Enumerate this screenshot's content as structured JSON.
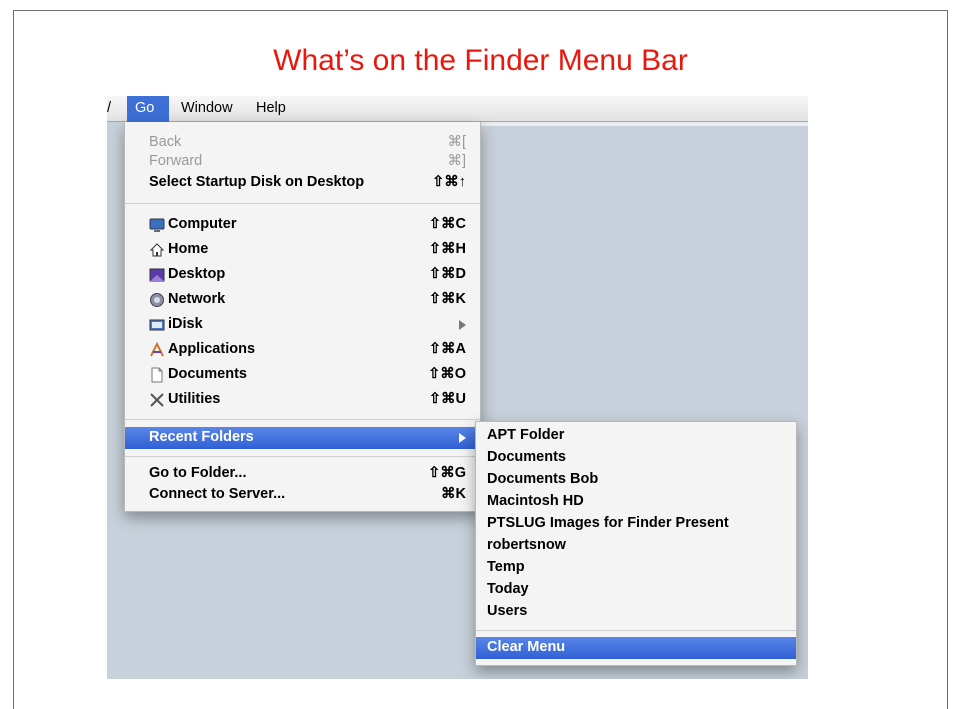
{
  "slide": {
    "title": "What’s on the Finder Menu Bar"
  },
  "menubar": {
    "cut_label": "/",
    "go": "Go",
    "window": "Window",
    "help": "Help"
  },
  "go_menu": {
    "back": {
      "label": "Back",
      "shortcut": "⌘["
    },
    "forward": {
      "label": "Forward",
      "shortcut": "⌘]"
    },
    "startup": {
      "label": "Select Startup Disk on Desktop",
      "shortcut": "⇧⌘↑"
    },
    "places": [
      {
        "label": "Computer",
        "shortcut": "⇧⌘C",
        "icon": "computer-icon"
      },
      {
        "label": "Home",
        "shortcut": "⇧⌘H",
        "icon": "home-icon"
      },
      {
        "label": "Desktop",
        "shortcut": "⇧⌘D",
        "icon": "desktop-icon"
      },
      {
        "label": "Network",
        "shortcut": "⇧⌘K",
        "icon": "network-icon"
      },
      {
        "label": "iDisk",
        "shortcut": "",
        "icon": "idisk-icon"
      },
      {
        "label": "Applications",
        "shortcut": "⇧⌘A",
        "icon": "applications-icon"
      },
      {
        "label": "Documents",
        "shortcut": "⇧⌘O",
        "icon": "documents-icon"
      },
      {
        "label": "Utilities",
        "shortcut": "⇧⌘U",
        "icon": "utilities-icon"
      }
    ],
    "recent": {
      "label": "Recent Folders"
    },
    "goto": {
      "label": "Go to Folder...",
      "shortcut": "⇧⌘G"
    },
    "connect": {
      "label": "Connect to Server...",
      "shortcut": "⌘K"
    }
  },
  "recent_menu": {
    "items": [
      "APT Folder",
      "Documents",
      "Documents Bob",
      "Macintosh HD",
      "PTSLUG Images for Finder Present",
      "robertsnow",
      "Temp",
      "Today",
      "Users"
    ],
    "clear": "Clear Menu"
  },
  "colors": {
    "title": "#e8180f",
    "highlight": "#3d6fd7",
    "desktop": "#c8d1db"
  }
}
